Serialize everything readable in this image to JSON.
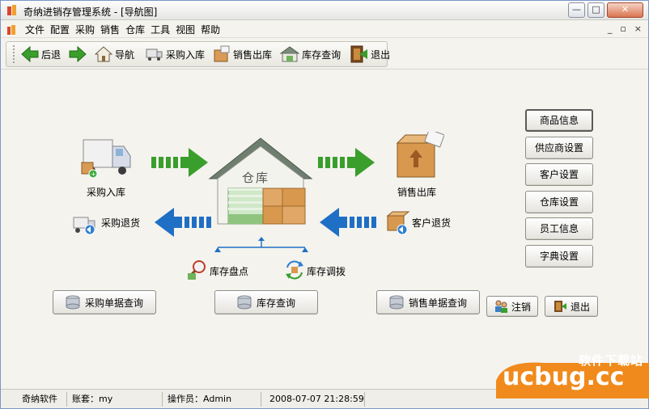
{
  "window": {
    "title": "奇纳进销存管理系统 - [导航图]",
    "minimize_glyph": "—",
    "maximize_glyph": "□",
    "close_glyph": "✕"
  },
  "menubar": {
    "items": [
      "文件",
      "配置",
      "采购",
      "销售",
      "仓库",
      "工具",
      "视图",
      "帮助"
    ],
    "mdi_minimize": "_",
    "mdi_restore": "▫",
    "mdi_close": "×"
  },
  "toolbar": {
    "back": "后退",
    "forward_icon": "forward-arrow-icon",
    "navigate": "导航",
    "purchase_in": "采购入库",
    "sales_out": "销售出库",
    "stock_query": "库存查询",
    "exit": "退出"
  },
  "flow": {
    "purchase_in": "采购入库",
    "purchase_return": "采购退货",
    "warehouse_sign": "仓库",
    "sales_out": "销售出库",
    "customer_return": "客户退货",
    "stock_check": "库存盘点",
    "stock_transfer": "库存调拨",
    "purchase_doc_query": "采购单据查询",
    "stock_query": "库存查询",
    "sales_doc_query": "销售单据查询",
    "logout": "注销",
    "exit": "退出"
  },
  "settings": {
    "items": [
      "商品信息",
      "供应商设置",
      "客户设置",
      "仓库设置",
      "员工信息",
      "字典设置"
    ]
  },
  "statusbar": {
    "company": "奇纳软件",
    "account": "账套：my",
    "operator": "操作员：Admin",
    "datetime": "2008-07-07 21:28:59"
  },
  "watermark": {
    "small": "软件下载站",
    "big": "ucbug.cc"
  },
  "colors": {
    "arrow_green": "#3a9e2c",
    "arrow_blue": "#1f6fc4",
    "orange_brand": "#f08a1c"
  }
}
